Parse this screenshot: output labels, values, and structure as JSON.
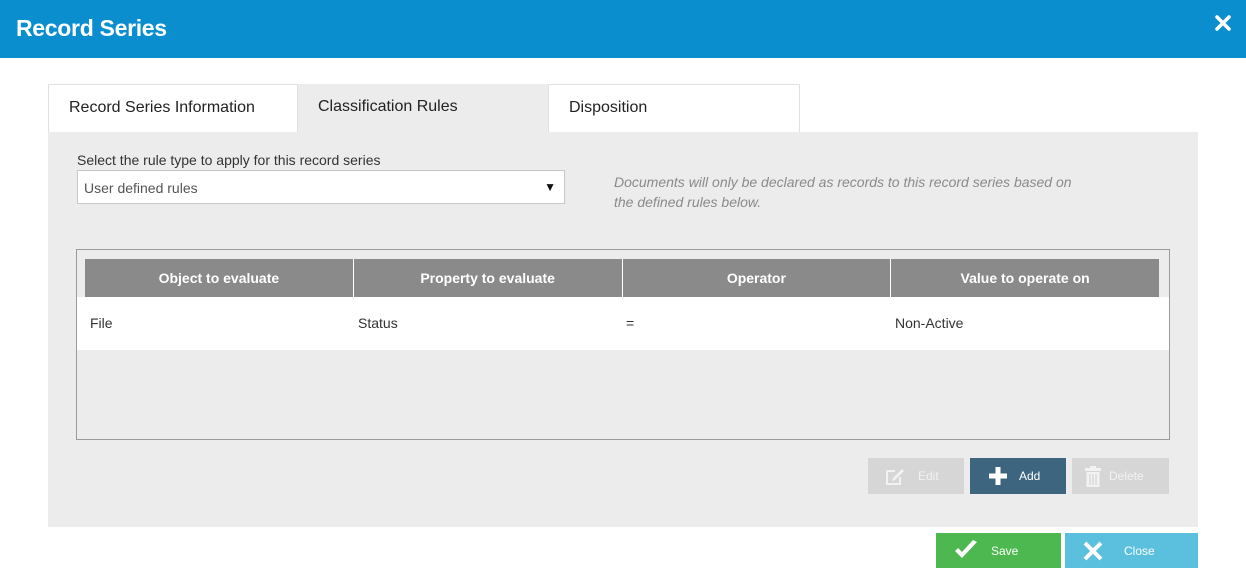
{
  "header": {
    "title": "Record Series",
    "close_icon": "close-icon"
  },
  "tabs": [
    {
      "label": "Record Series Information",
      "active": false
    },
    {
      "label": "Classification Rules",
      "active": true
    },
    {
      "label": "Disposition",
      "active": false
    }
  ],
  "rules": {
    "label": "Select the rule type to apply for this record series",
    "selected": "User defined rules",
    "hint": "Documents will only be declared as records to this record series based on the defined rules below."
  },
  "grid": {
    "columns": [
      "Object to evaluate",
      "Property to evaluate",
      "Operator",
      "Value to operate on"
    ],
    "rows": [
      {
        "object": "File",
        "property": "Status",
        "operator": "=",
        "value": "Non-Active"
      }
    ]
  },
  "actions": {
    "edit_label": "Edit",
    "add_label": "Add",
    "delete_label": "Delete"
  },
  "footer": {
    "save_label": "Save",
    "close_label": "Close"
  },
  "colors": {
    "header": "#0a8ecd",
    "add": "#3d6580",
    "save": "#4cb84f",
    "close": "#5bc0de",
    "disabled": "#d6d6d6"
  }
}
